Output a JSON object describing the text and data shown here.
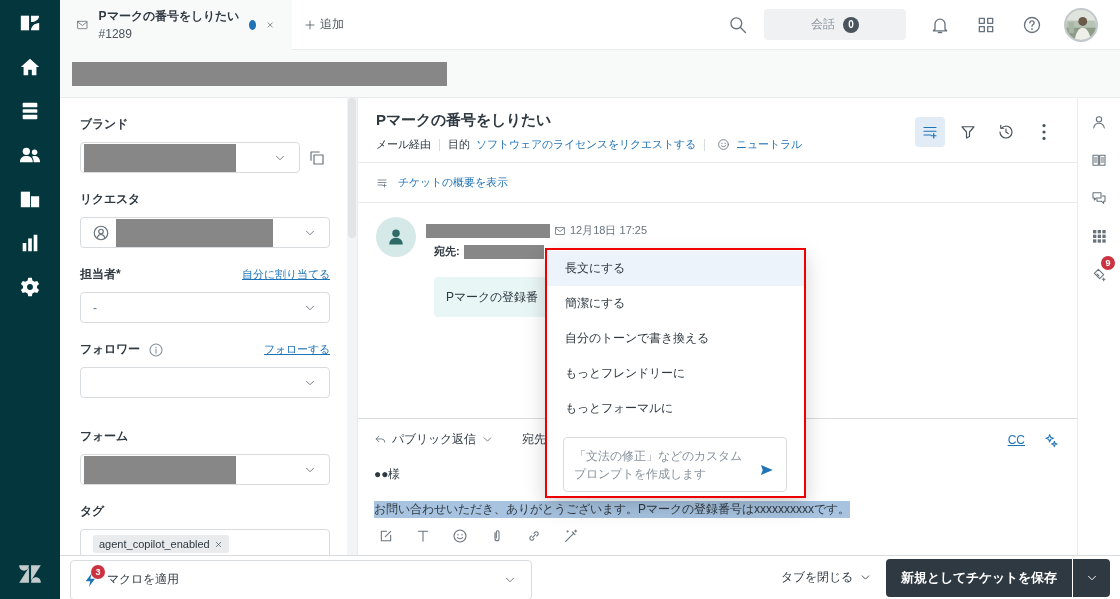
{
  "top_bar": {
    "tab": {
      "title": "Pマークの番号をしりたい",
      "number": "#1289",
      "unsaved": true
    },
    "add_label": "追加",
    "conversations": {
      "label": "会話",
      "count": "0"
    }
  },
  "sub_bar": {
    "redacted": true
  },
  "left_panel": {
    "fields": [
      {
        "kind": "select",
        "label": "ブランド",
        "redacted": true,
        "copy": true
      },
      {
        "kind": "requester",
        "label": "リクエスタ",
        "redacted": true
      },
      {
        "kind": "select",
        "label": "担当者*",
        "action": "自分に割り当てる",
        "value": "-"
      },
      {
        "kind": "select",
        "label": "フォロワー",
        "info": true,
        "action": "フォローする"
      },
      {
        "kind": "divider"
      },
      {
        "kind": "select",
        "label": "フォーム",
        "redacted": true
      },
      {
        "kind": "tags",
        "label": "タグ",
        "tags": [
          "agent_copilot_enabled"
        ]
      }
    ]
  },
  "ticket": {
    "title": "Pマークの番号をしりたい",
    "channel": "メール経由",
    "intent_label": "目的",
    "intent": "ソフトウェアのライセンスをリクエストする",
    "sentiment": "ニュートラル",
    "summary_link": "チケットの概要を表示",
    "tools": [
      {
        "kind": "summary",
        "selected": true
      },
      {
        "kind": "filter",
        "selected": false
      },
      {
        "kind": "history",
        "selected": false
      },
      {
        "kind": "more",
        "selected": false
      }
    ]
  },
  "message": {
    "time": "12月18日 17:25",
    "to_label": "宛先:",
    "body": "Pマークの登録番"
  },
  "composer": {
    "mode": "パブリック返信",
    "to_label": "宛先",
    "cc": "CC",
    "greeting": "●●様",
    "body": "お問い合わせいただき、ありがとうございます。Pマークの登録番号はxxxxxxxxxxです。",
    "body_selected": true
  },
  "rewrite_menu": {
    "items": [
      {
        "label": "長文にする",
        "selected": true
      },
      {
        "label": "簡潔にする",
        "selected": false
      },
      {
        "label": "自分のトーンで書き換える",
        "selected": false
      },
      {
        "label": "もっとフレンドリーに",
        "selected": false
      },
      {
        "label": "もっとフォーマルに",
        "selected": false
      }
    ],
    "prompt_placeholder": "「文法の修正」などのカスタムプロンプトを作成します"
  },
  "right_rail": {
    "badge": "9"
  },
  "bottom_bar": {
    "macro": "マクロを適用",
    "macro_badge": "3",
    "close_tab": "タブを閉じる",
    "save": "新規としてチケットを保存"
  }
}
